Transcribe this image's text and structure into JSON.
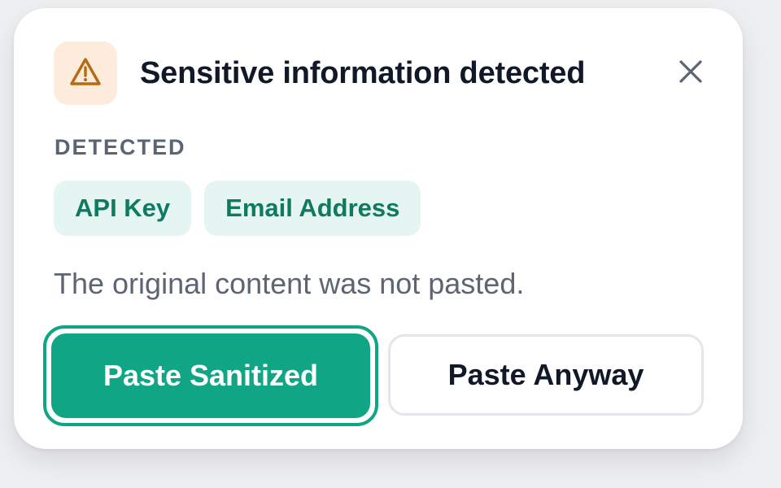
{
  "dialog": {
    "title": "Sensitive information detected",
    "warning_icon": "warning-triangle-icon",
    "close_icon": "close-icon",
    "section_label": "DETECTED",
    "detected_items": [
      "API Key",
      "Email Address"
    ],
    "message": "The original content was not pasted.",
    "primary_button": "Paste Sanitized",
    "secondary_button": "Paste Anyway"
  },
  "colors": {
    "accent": "#10a585",
    "warning_bg": "#fdebdc",
    "warning_fg": "#b86a12",
    "chip_bg": "#e5f5f1",
    "chip_text": "#0f7a5f"
  }
}
